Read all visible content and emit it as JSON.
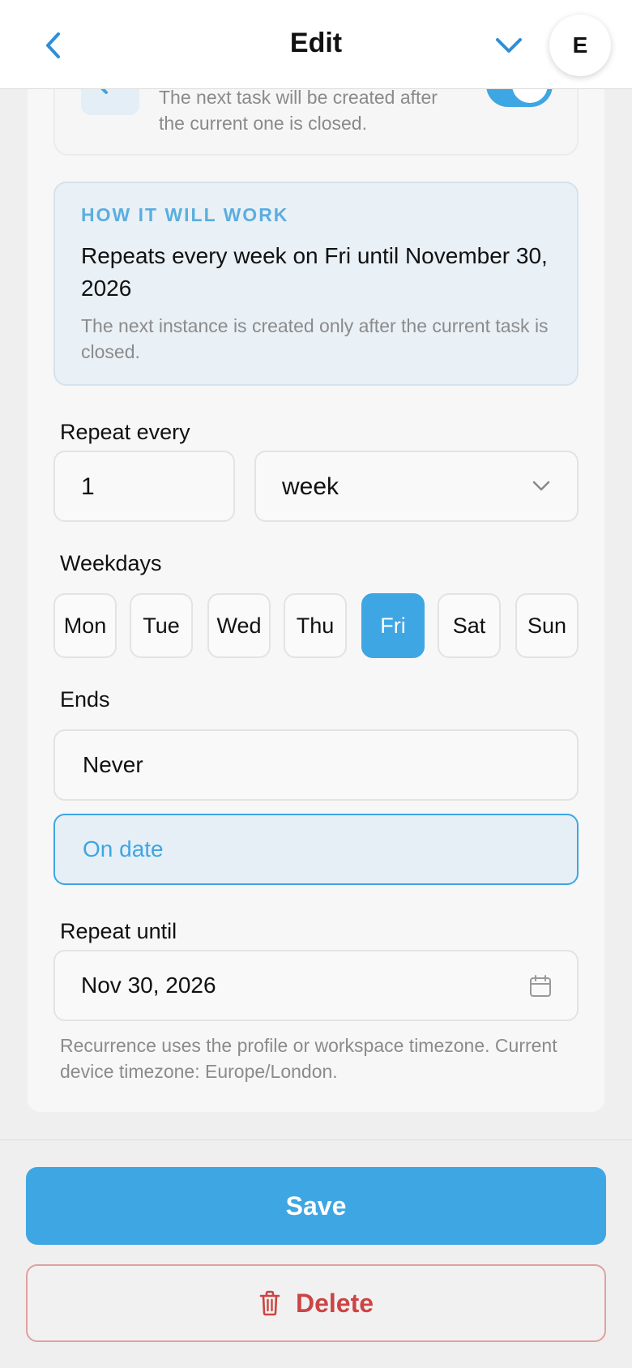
{
  "header": {
    "title": "Edit",
    "avatar_initial": "E"
  },
  "top_card": {
    "text": "The next task will be created after the current one is closed.",
    "toggle_on": true
  },
  "info": {
    "kicker": "HOW IT WILL WORK",
    "summary": "Repeats every week on Fri until November 30, 2026",
    "note": "The next instance is created only after the current task is closed."
  },
  "repeat_every": {
    "label": "Repeat every",
    "interval_value": "1",
    "unit_value": "week"
  },
  "weekdays": {
    "label": "Weekdays",
    "days": [
      {
        "label": "Mon",
        "selected": false
      },
      {
        "label": "Tue",
        "selected": false
      },
      {
        "label": "Wed",
        "selected": false
      },
      {
        "label": "Thu",
        "selected": false
      },
      {
        "label": "Fri",
        "selected": true
      },
      {
        "label": "Sat",
        "selected": false
      },
      {
        "label": "Sun",
        "selected": false
      }
    ]
  },
  "ends": {
    "label": "Ends",
    "options": [
      {
        "label": "Never",
        "selected": false
      },
      {
        "label": "On date",
        "selected": true
      }
    ]
  },
  "repeat_until": {
    "label": "Repeat until",
    "value": "Nov 30, 2026"
  },
  "footnote": "Recurrence uses the profile or workspace timezone. Current device timezone: Europe/London.",
  "actions": {
    "save_label": "Save",
    "delete_label": "Delete"
  },
  "colors": {
    "accent": "#3ea6e3",
    "danger": "#cc4444",
    "info_bg": "#e9f0f6"
  }
}
